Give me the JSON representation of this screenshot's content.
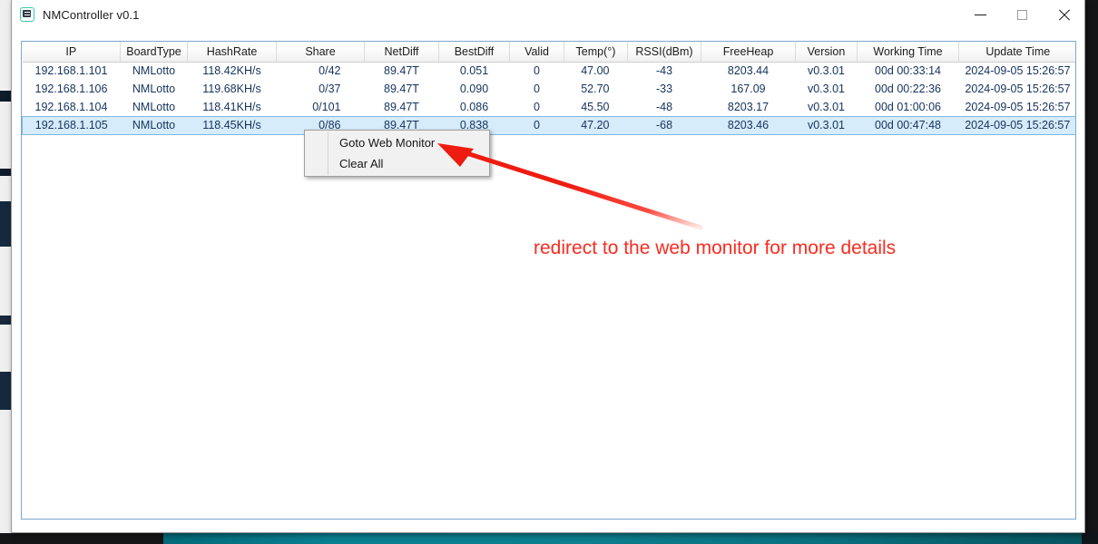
{
  "window": {
    "title": "NMController v0.1",
    "icon": "app-monitor-icon",
    "controls": {
      "minimize": "minimize",
      "maximize": "maximize",
      "close": "close"
    }
  },
  "table": {
    "columns": [
      "IP",
      "BoardType",
      "HashRate",
      "Share",
      "NetDiff",
      "BestDiff",
      "Valid",
      "Temp(°)",
      "RSSI(dBm)",
      "FreeHeap",
      "Version",
      "Working Time",
      "Update Time"
    ],
    "rows": [
      {
        "ip": "192.168.1.101",
        "board_type": "NMLotto",
        "hash_rate": "118.42KH/s",
        "share": "0/42",
        "net_diff": "89.47T",
        "best_diff": "0.051",
        "valid": "0",
        "temp": "47.00",
        "rssi": "-43",
        "free_heap": "8203.44",
        "version": "v0.3.01",
        "working_time": "00d 00:33:14",
        "update_time": "2024-09-05 15:26:57",
        "selected": false
      },
      {
        "ip": "192.168.1.106",
        "board_type": "NMLotto",
        "hash_rate": "119.68KH/s",
        "share": "0/37",
        "net_diff": "89.47T",
        "best_diff": "0.090",
        "valid": "0",
        "temp": "52.70",
        "rssi": "-33",
        "free_heap": "167.09",
        "version": "v0.3.01",
        "working_time": "00d 00:22:36",
        "update_time": "2024-09-05 15:26:57",
        "selected": false
      },
      {
        "ip": "192.168.1.104",
        "board_type": "NMLotto",
        "hash_rate": "118.41KH/s",
        "share": "0/101",
        "net_diff": "89.47T",
        "best_diff": "0.086",
        "valid": "0",
        "temp": "45.50",
        "rssi": "-48",
        "free_heap": "8203.17",
        "version": "v0.3.01",
        "working_time": "00d 01:00:06",
        "update_time": "2024-09-05 15:26:57",
        "selected": false
      },
      {
        "ip": "192.168.1.105",
        "board_type": "NMLotto",
        "hash_rate": "118.45KH/s",
        "share": "0/86",
        "net_diff": "89.47T",
        "best_diff": "0.838",
        "valid": "0",
        "temp": "47.20",
        "rssi": "-68",
        "free_heap": "8203.46",
        "version": "v0.3.01",
        "working_time": "00d 00:47:48",
        "update_time": "2024-09-05 15:26:57",
        "selected": true
      }
    ]
  },
  "context_menu": {
    "items": [
      {
        "label": "Goto Web Monitor"
      },
      {
        "label": "Clear All"
      }
    ]
  },
  "annotation": {
    "text": "redirect to the web monitor for more details",
    "color": "#fa2b20",
    "arrow": "red-arrow-pointing-to-menu"
  },
  "colors": {
    "selection_bg": "#d6ecfb",
    "selection_border": "#7eb6e0",
    "grid_border": "#7ba7cf",
    "cell_text": "#16325c",
    "taskbar_teal": "#0a8092"
  }
}
